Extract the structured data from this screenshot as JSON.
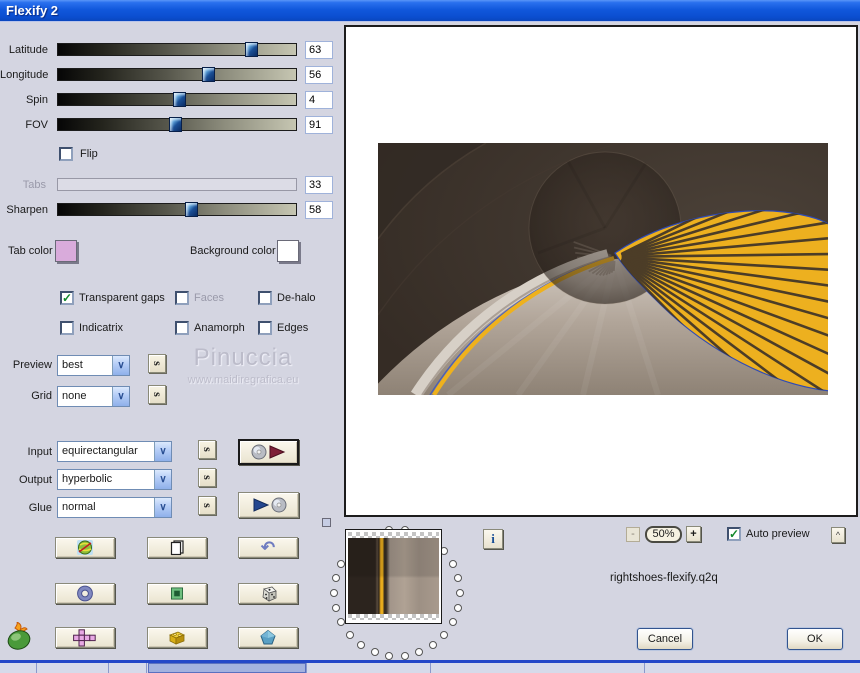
{
  "window": {
    "title": "Flexify 2"
  },
  "sliders": [
    {
      "label": "Latitude",
      "value": "63",
      "pos": "81%"
    },
    {
      "label": "Longitude",
      "value": "56",
      "pos": "63%"
    },
    {
      "label": "Spin",
      "value": "4",
      "pos": "51%"
    },
    {
      "label": "FOV",
      "value": "91",
      "pos": "49%"
    },
    {
      "label": "Tabs",
      "value": "33",
      "pos": ""
    },
    {
      "label": "Sharpen",
      "value": "58",
      "pos": "56%"
    }
  ],
  "flip": {
    "label": "Flip",
    "mark": ""
  },
  "swatches": {
    "tab_label": "Tab color",
    "tab_color": "#d9abdb",
    "bg_label": "Background color",
    "bg_color": "#ffffff"
  },
  "options": {
    "row1": [
      {
        "label": "Transparent gaps",
        "mark": "✓",
        "disabled": false
      },
      {
        "label": "Faces",
        "mark": "",
        "disabled": true
      },
      {
        "label": "De-halo",
        "mark": "",
        "disabled": false
      }
    ],
    "row2": [
      {
        "label": "Indicatrix",
        "mark": "",
        "disabled": false
      },
      {
        "label": "Anamorph",
        "mark": "",
        "disabled": false
      },
      {
        "label": "Edges",
        "mark": "",
        "disabled": false
      }
    ]
  },
  "render": {
    "preview_label": "Preview",
    "preview_value": "best",
    "grid_label": "Grid",
    "grid_value": "none",
    "s_label": "s",
    "arrow_glyph": "∨"
  },
  "watermark": {
    "line1": "Pinuccia",
    "line2": "www.maidiregrafica.eu"
  },
  "mapping": [
    {
      "label": "Input",
      "value": "equirectangular"
    },
    {
      "label": "Output",
      "value": "hyperbolic"
    },
    {
      "label": "Glue",
      "value": "normal"
    }
  ],
  "footer": {
    "info_label": "i",
    "zoom_out": "-",
    "zoom_value": "50%",
    "zoom_in": "+",
    "auto_preview_label": "Auto preview",
    "auto_preview_mark": "✓",
    "collapse_label": "^",
    "filename": "rightshoes-flexify.q2q",
    "cancel_label": "Cancel",
    "ok_label": "OK",
    "undo_glyph": "↶"
  },
  "accent_colors": {
    "titlebar_blue": "#0b4ed0",
    "art_yellow": "#eeb11d",
    "art_brown": "#3a3029"
  }
}
